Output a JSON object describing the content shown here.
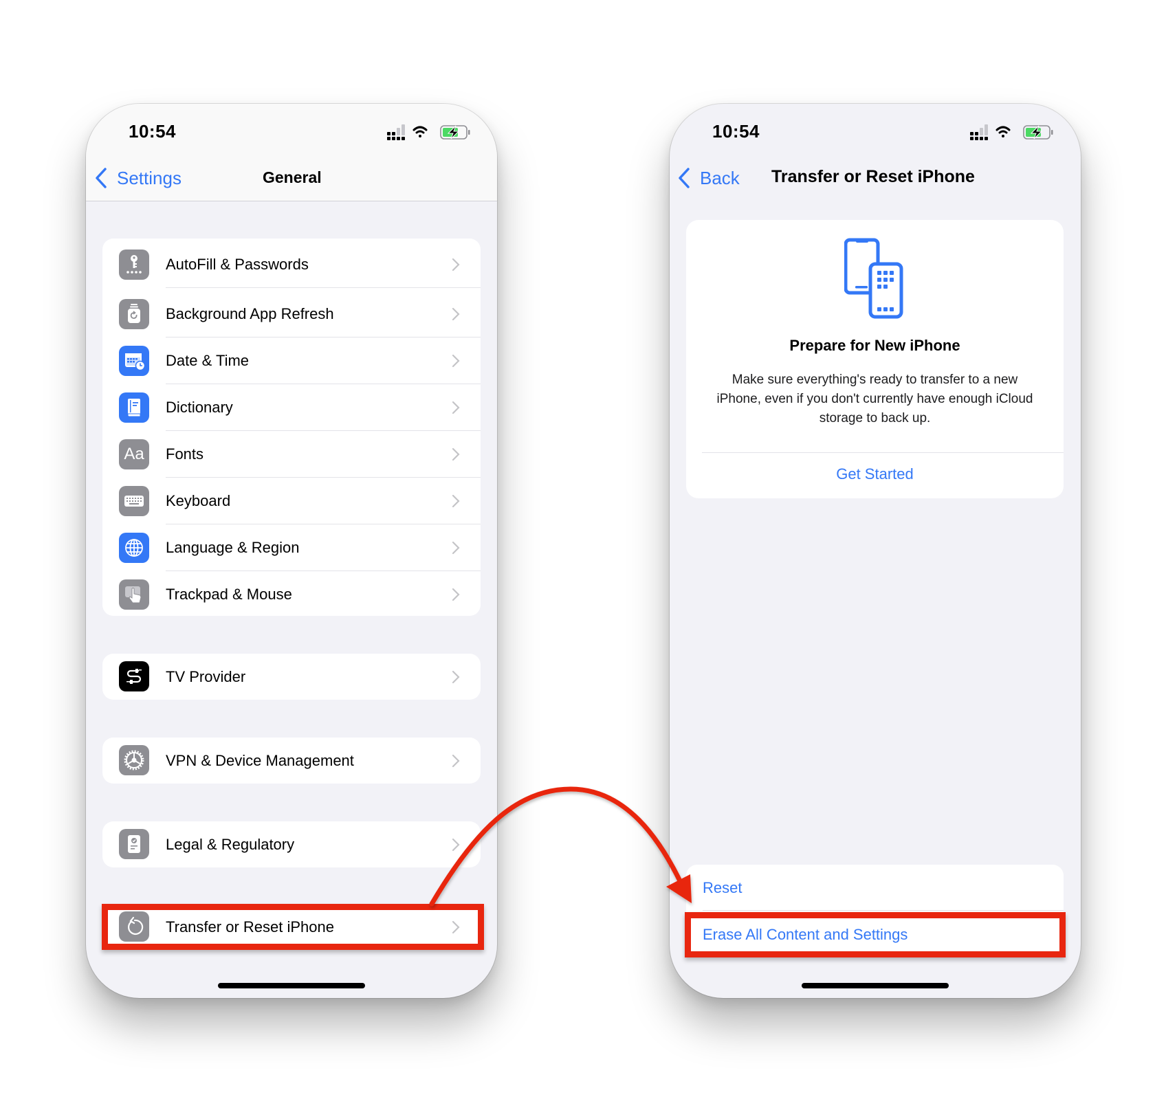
{
  "left_phone": {
    "status": {
      "time": "10:54"
    },
    "nav": {
      "back_label": "Settings",
      "title": "General"
    },
    "groups": [
      {
        "items": [
          {
            "label": "AutoFill & Passwords",
            "icon": "key-icon",
            "color": "#8e8e93"
          },
          {
            "label": "Background App Refresh",
            "icon": "app-refresh-icon",
            "color": "#8e8e93"
          },
          {
            "label": "Date & Time",
            "icon": "calendar-clock-icon",
            "color": "#3478f6"
          },
          {
            "label": "Dictionary",
            "icon": "book-icon",
            "color": "#3478f6"
          },
          {
            "label": "Fonts",
            "icon": "fonts-icon",
            "glyph": "Aa",
            "color": "#8e8e93"
          },
          {
            "label": "Keyboard",
            "icon": "keyboard-icon",
            "color": "#8e8e93"
          },
          {
            "label": "Language & Region",
            "icon": "globe-icon",
            "color": "#3478f6"
          },
          {
            "label": "Trackpad & Mouse",
            "icon": "trackpad-icon",
            "color": "#8e8e93"
          }
        ]
      },
      {
        "items": [
          {
            "label": "TV Provider",
            "icon": "tv-provider-icon",
            "color": "#000000"
          }
        ]
      },
      {
        "items": [
          {
            "label": "VPN & Device Management",
            "icon": "gear-icon",
            "color": "#8e8e93"
          }
        ]
      },
      {
        "items": [
          {
            "label": "Legal & Regulatory",
            "icon": "legal-document-icon",
            "color": "#8e8e93"
          }
        ]
      },
      {
        "items": [
          {
            "label": "Transfer or Reset iPhone",
            "icon": "reset-arrow-icon",
            "color": "#8e8e93",
            "highlighted": true
          }
        ]
      }
    ]
  },
  "right_phone": {
    "status": {
      "time": "10:54"
    },
    "nav": {
      "back_label": "Back",
      "title": "Transfer or Reset iPhone"
    },
    "prepare_card": {
      "icon": "two-phones-icon",
      "title": "Prepare for New iPhone",
      "body": "Make sure everything's ready to transfer to a new iPhone, even if you don't currently have enough iCloud storage to back up.",
      "action": "Get Started"
    },
    "reset_group": {
      "items": [
        {
          "label": "Reset"
        },
        {
          "label": "Erase All Content and Settings",
          "highlighted": true
        }
      ]
    }
  },
  "annotations": {
    "highlight_color": "#e8260f",
    "arrow": "from Transfer or Reset iPhone to Erase All Content and Settings"
  },
  "colors": {
    "accent": "#3478f6",
    "background": "#f2f2f7",
    "battery": "#4cd964"
  }
}
